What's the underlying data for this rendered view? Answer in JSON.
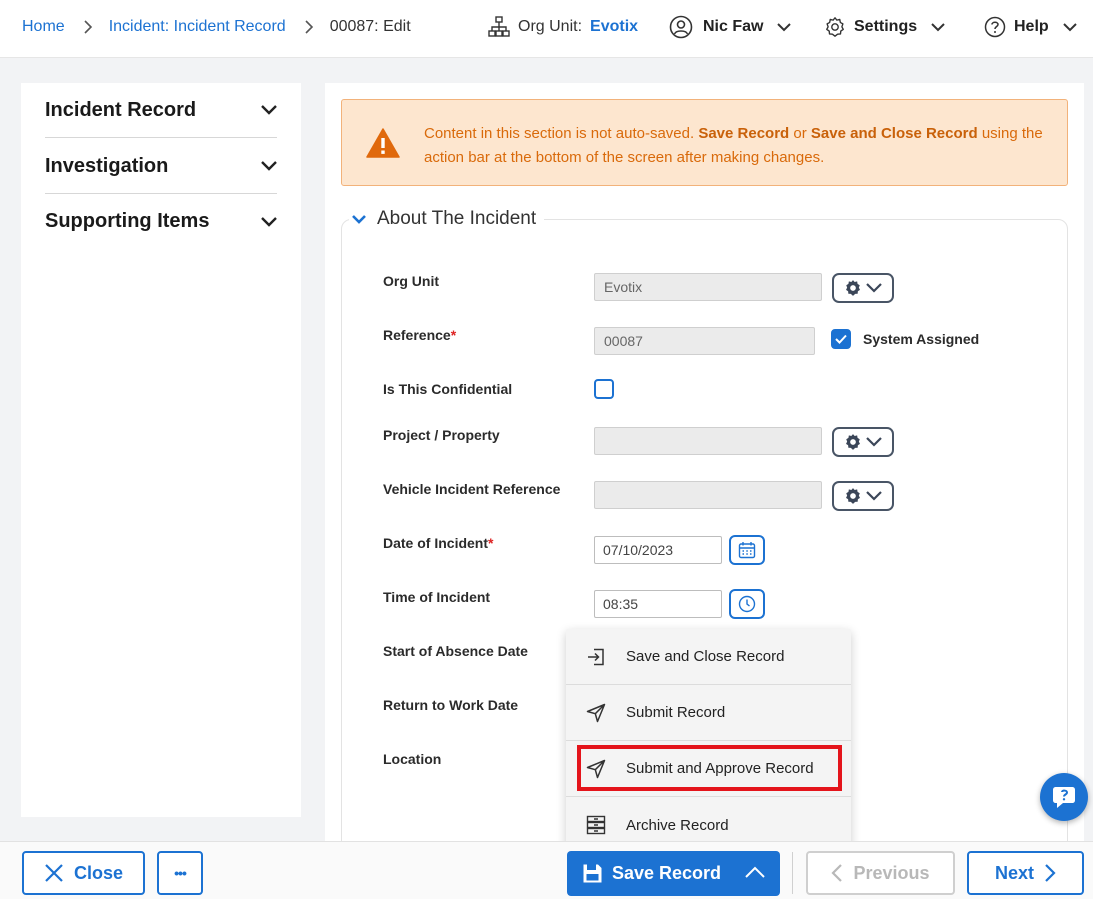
{
  "topbar": {
    "breadcrumb": {
      "home": "Home",
      "module": "Incident: Incident Record",
      "current": "00087: Edit"
    },
    "org_unit_label": "Org Unit:",
    "org_unit_value": "Evotix",
    "user_name": "Nic Faw",
    "settings_label": "Settings",
    "help_label": "Help"
  },
  "sidebar": {
    "items": [
      {
        "label": "Incident Record"
      },
      {
        "label": "Investigation"
      },
      {
        "label": "Supporting Items"
      }
    ]
  },
  "warning": {
    "text_before": "Content in this section is not auto-saved.",
    "save_record": "Save Record",
    "or": "or",
    "save_close": "Save and Close Record",
    "text_after": "using the action bar at the bottom of the screen after making changes."
  },
  "section": {
    "title": "About The Incident"
  },
  "fields": {
    "org_unit": {
      "label": "Org Unit",
      "value": "Evotix"
    },
    "reference": {
      "label": "Reference",
      "value": "00087",
      "system_assigned_label": "System Assigned",
      "system_assigned": true
    },
    "confidential": {
      "label": "Is This Confidential",
      "checked": false
    },
    "project": {
      "label": "Project / Property",
      "value": ""
    },
    "vehicle": {
      "label": "Vehicle Incident Reference",
      "value": ""
    },
    "date": {
      "label": "Date of Incident",
      "value": "07/10/2023"
    },
    "time": {
      "label": "Time of Incident",
      "value": "08:35"
    },
    "absence": {
      "label": "Start of Absence Date"
    },
    "return": {
      "label": "Return to Work Date"
    },
    "location": {
      "label": "Location"
    }
  },
  "required_mark": "*",
  "menu": {
    "items": [
      {
        "label": "Save and Close Record",
        "icon": "sign-in-icon"
      },
      {
        "label": "Submit Record",
        "icon": "paper-plane-icon"
      },
      {
        "label": "Submit and Approve Record",
        "icon": "paper-plane-icon"
      },
      {
        "label": "Archive Record",
        "icon": "archive-icon"
      }
    ],
    "highlighted_item": "Submit and Approve Record",
    "highlight_color": "#e4141b"
  },
  "bottombar": {
    "close_label": "Close",
    "more_label": "•••",
    "save_label": "Save Record",
    "previous_label": "Previous",
    "next_label": "Next"
  },
  "colors": {
    "accent": "#1c72d2",
    "warning_bg": "#fde6cf",
    "warning_text": "#d96a0b",
    "required": "#dd2222"
  }
}
